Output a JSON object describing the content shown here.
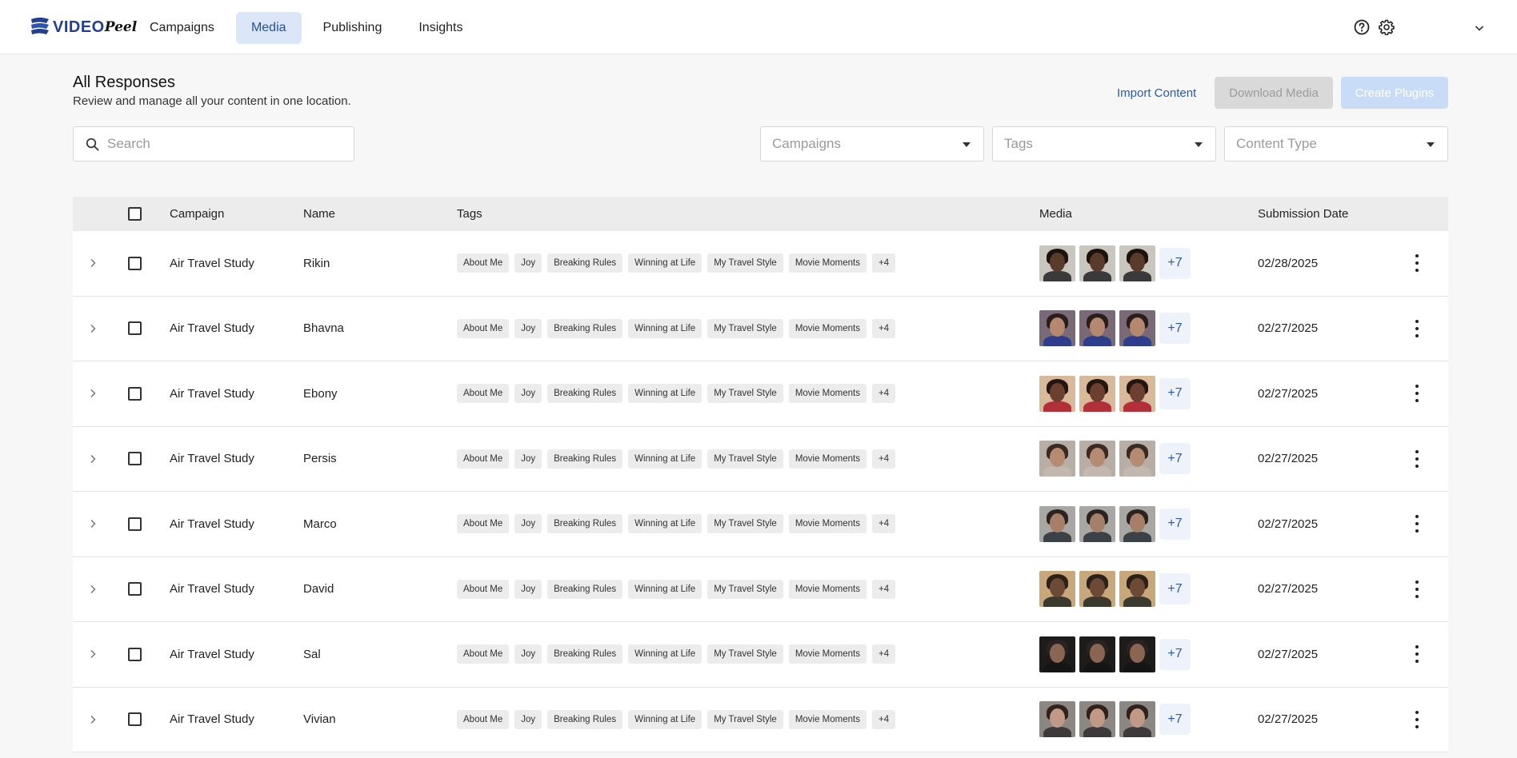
{
  "app": {
    "logo_text": "VIDEO",
    "logo_script": "Peel",
    "nav": [
      {
        "label": "Campaigns",
        "active": false
      },
      {
        "label": "Media",
        "active": true
      },
      {
        "label": "Publishing",
        "active": false
      },
      {
        "label": "Insights",
        "active": false
      }
    ],
    "icons": {
      "help": "help-circle-icon",
      "settings": "gear-icon",
      "account": "chevron-down-icon"
    }
  },
  "header": {
    "title": "All Responses",
    "subtitle": "Review and manage all your content in one location.",
    "import_label": "Import Content",
    "download_label": "Download Media",
    "create_label": "Create Plugins"
  },
  "filters": {
    "search_placeholder": "Search",
    "campaigns_placeholder": "Campaigns",
    "tags_placeholder": "Tags",
    "content_type_placeholder": "Content Type"
  },
  "table": {
    "columns": {
      "campaign": "Campaign",
      "name": "Name",
      "tags": "Tags",
      "media": "Media",
      "date": "Submission Date"
    },
    "tag_labels": [
      "About Me",
      "Joy",
      "Breaking Rules",
      "Winning at Life",
      "My Travel Style",
      "Movie Moments",
      "+4"
    ],
    "media_more": "+7",
    "rows": [
      {
        "campaign": "Air Travel Study",
        "name": "Rikin",
        "date": "02/28/2025",
        "palette": {
          "bg": "#c9c5bf",
          "skin": "#5a3a2a",
          "hair": "#1c130e",
          "shirt": "#3a3a3a"
        }
      },
      {
        "campaign": "Air Travel Study",
        "name": "Bhavna",
        "date": "02/27/2025",
        "palette": {
          "bg": "#7a6a78",
          "skin": "#b78870",
          "hair": "#2a1d1a",
          "shirt": "#2d3e8c"
        }
      },
      {
        "campaign": "Air Travel Study",
        "name": "Ebony",
        "date": "02/27/2025",
        "palette": {
          "bg": "#d8b99a",
          "skin": "#6b4030",
          "hair": "#24150f",
          "shirt": "#b3303a"
        }
      },
      {
        "campaign": "Air Travel Study",
        "name": "Persis",
        "date": "02/27/2025",
        "palette": {
          "bg": "#b8aea6",
          "skin": "#b58b72",
          "hair": "#3a2a22",
          "shirt": "#c2b8b0"
        }
      },
      {
        "campaign": "Air Travel Study",
        "name": "Marco",
        "date": "02/27/2025",
        "palette": {
          "bg": "#a9a7a4",
          "skin": "#a57f68",
          "hair": "#2b2320",
          "shirt": "#3c4148"
        }
      },
      {
        "campaign": "Air Travel Study",
        "name": "David",
        "date": "02/27/2025",
        "palette": {
          "bg": "#c8a77a",
          "skin": "#6d4a36",
          "hair": "#2c2118",
          "shirt": "#3c3a2e"
        }
      },
      {
        "campaign": "Air Travel Study",
        "name": "Sal",
        "date": "02/27/2025",
        "palette": {
          "bg": "#1e1c1b",
          "skin": "#8a6552",
          "hair": "#2a2220",
          "shirt": "#151515"
        }
      },
      {
        "campaign": "Air Travel Study",
        "name": "Vivian",
        "date": "02/27/2025",
        "palette": {
          "bg": "#8d8783",
          "skin": "#c09a86",
          "hair": "#2f221d",
          "shirt": "#3c3a3a"
        }
      }
    ]
  }
}
